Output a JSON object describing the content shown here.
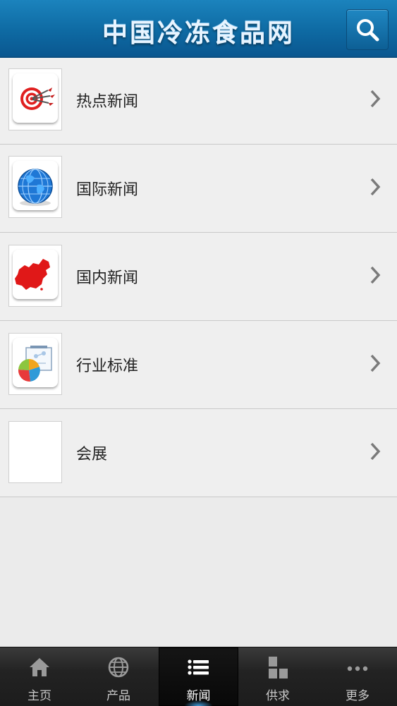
{
  "header": {
    "title": "中国冷冻食品网",
    "search_icon": "search-icon"
  },
  "list": {
    "items": [
      {
        "label": "热点新闻",
        "icon": "target-icon"
      },
      {
        "label": "国际新闻",
        "icon": "globe-icon"
      },
      {
        "label": "国内新闻",
        "icon": "china-map-icon"
      },
      {
        "label": "行业标准",
        "icon": "pie-chart-board-icon"
      },
      {
        "label": "会展",
        "icon": "blank-thumbnail"
      }
    ]
  },
  "tabbar": {
    "active": "新闻",
    "tabs": [
      {
        "label": "主页",
        "icon": "home-icon"
      },
      {
        "label": "产品",
        "icon": "globe-outline-icon"
      },
      {
        "label": "新闻",
        "icon": "list-icon"
      },
      {
        "label": "供求",
        "icon": "blocks-icon"
      },
      {
        "label": "更多",
        "icon": "more-dots-icon"
      }
    ]
  },
  "colors": {
    "header_blue": "#0e6aa3",
    "background": "#ebebeb",
    "tabbar": "#232323",
    "active_glow": "#46aaf0"
  }
}
